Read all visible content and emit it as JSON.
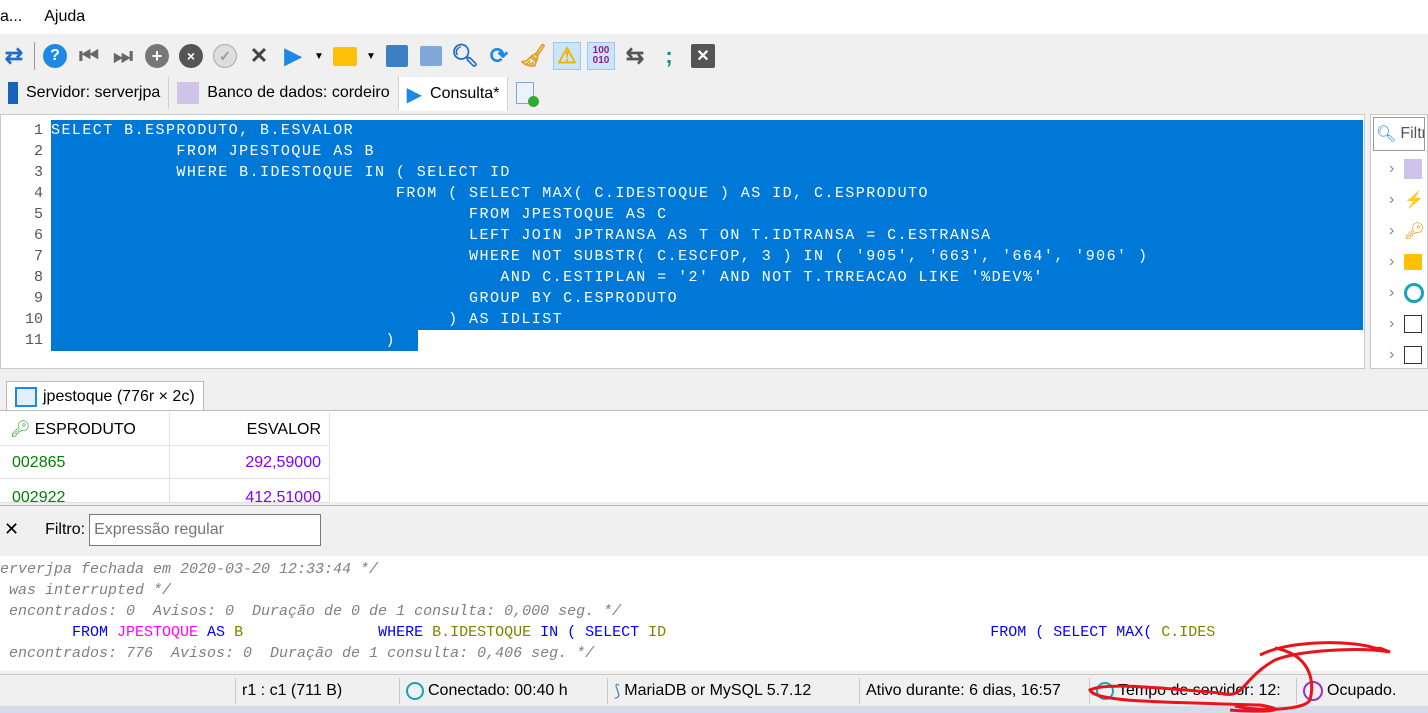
{
  "menu": {
    "items": [
      "a...",
      "Ajuda"
    ]
  },
  "toolbar": {
    "icons": [
      "disconnect-icon",
      "help-icon",
      "first-icon",
      "last-icon",
      "add-icon",
      "remove-icon",
      "post-icon",
      "cancel-icon",
      "run-icon",
      "dropdown-icon",
      "open-icon",
      "dropdown-icon",
      "save-icon",
      "save-as-icon",
      "find-icon",
      "replace-icon",
      "clear-icon",
      "stop-on-error-icon",
      "binary-icon",
      "wrap-icon",
      "semicolon-icon",
      "close-icon"
    ]
  },
  "tabs": [
    {
      "label": "Servidor: serverjpa"
    },
    {
      "label": "Banco de dados: cordeiro"
    },
    {
      "label": "Consulta*"
    }
  ],
  "editor": {
    "lines": [
      "SELECT B.ESPRODUTO, B.ESVALOR",
      "            FROM JPESTOQUE AS B",
      "            WHERE B.IDESTOQUE IN ( SELECT ID",
      "                                 FROM ( SELECT MAX( C.IDESTOQUE ) AS ID, C.ESPRODUTO",
      "                                        FROM JPESTOQUE AS C",
      "                                        LEFT JOIN JPTRANSA AS T ON T.IDTRANSA = C.ESTRANSA",
      "                                        WHERE NOT SUBSTR( C.ESCFOP, 3 ) IN ( '905', '663', '664', '906' )",
      "                                           AND C.ESTIPLAN = '2' AND NOT T.TRREACAO LIKE '%DEV%'",
      "                                        GROUP BY C.ESPRODUTO",
      "                                      ) AS IDLIST",
      "                                )"
    ]
  },
  "side": {
    "filter_placeholder": "Filtro"
  },
  "result": {
    "tab_label": "jpestoque (776r × 2c)",
    "columns": [
      "ESPRODUTO",
      "ESVALOR"
    ],
    "rows": [
      [
        "002865",
        "292,59000"
      ],
      [
        "002922",
        "412,51000"
      ]
    ]
  },
  "filter": {
    "label": "Filtro:",
    "placeholder": "Expressão regular"
  },
  "log": {
    "l1": "erverjpa fechada em 2020-03-20 12:33:44 */",
    "l2": " was interrupted */",
    "l3": " encontrados: 0  Avisos: 0  Duração de 0 de 1 consulta: 0,000 seg. */",
    "l4": {
      "a": "        FROM ",
      "b": "JPESTOQUE",
      "c": " AS ",
      "d": "B",
      "e": "               WHERE ",
      "f": "B.IDESTOQUE",
      "g": " IN ( SELECT ",
      "h": "ID",
      "i": "                                    FROM ( SELECT MAX( ",
      "j": "C.IDES"
    },
    "l5": " encontrados: 776  Avisos: 0  Duração de 1 consulta: 0,406 seg. */"
  },
  "status": {
    "pos": "r1 : c1 (711 B)",
    "connected": "Conectado: 00:40 h",
    "server": "MariaDB or MySQL 5.7.12",
    "uptime": "Ativo durante: 6 dias, 16:57",
    "server_time": "Tempo de servidor: 12:",
    "busy": "Ocupado."
  },
  "colors": {
    "selection": "#0078d7",
    "annotation": "#e8141b"
  }
}
